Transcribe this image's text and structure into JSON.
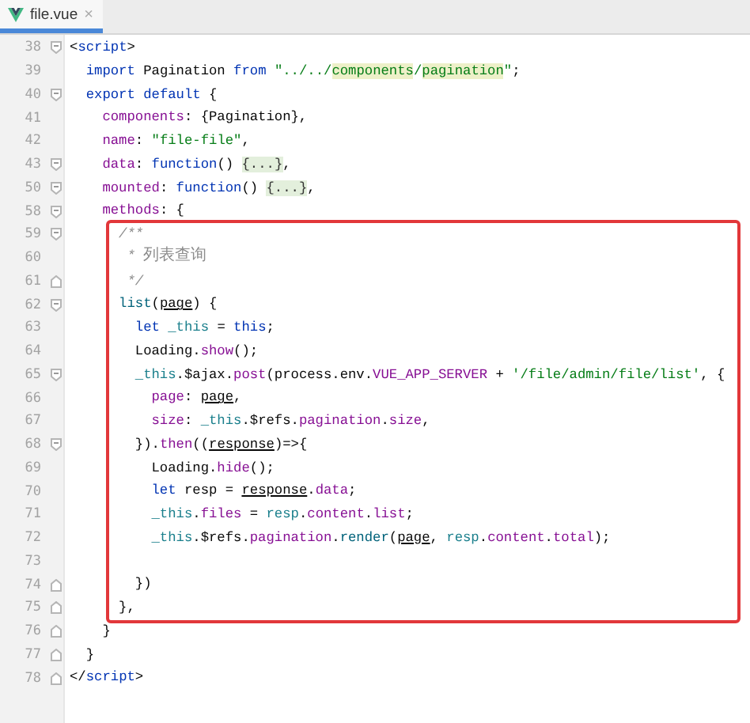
{
  "tab": {
    "label": "file.vue",
    "selected": true,
    "close": "×"
  },
  "editor": {
    "blocks": [
      {
        "highlighted": false,
        "lines": [
          {
            "number": "38",
            "fold_start": true,
            "fold_end": false,
            "tokens": [
              {
                "text": "<",
                "kind": "plain"
              },
              {
                "text": "script",
                "kind": "tag"
              },
              {
                "text": ">",
                "kind": "plain"
              }
            ]
          },
          {
            "number": "39",
            "fold_start": false,
            "fold_end": false,
            "tokens": [
              {
                "text": "  import",
                "kind": "keyword"
              },
              {
                "text": " Pagination ",
                "kind": "plain"
              },
              {
                "text": "from",
                "kind": "keyword"
              },
              {
                "text": " \"../../",
                "kind": "string"
              },
              {
                "text": "components",
                "kind": "string-hl"
              },
              {
                "text": "/",
                "kind": "string"
              },
              {
                "text": "pagination",
                "kind": "string-hl"
              },
              {
                "text": "\"",
                "kind": "string"
              },
              {
                "text": ";",
                "kind": "plain"
              }
            ]
          },
          {
            "number": "40",
            "fold_start": true,
            "fold_end": false,
            "tokens": [
              {
                "text": "  export",
                "kind": "keyword"
              },
              {
                "text": " default",
                "kind": "keyword"
              },
              {
                "text": " {",
                "kind": "plain"
              }
            ]
          },
          {
            "number": "41",
            "fold_start": false,
            "fold_end": false,
            "tokens": [
              {
                "text": "    components",
                "kind": "prop"
              },
              {
                "text": ": {Pagination},",
                "kind": "plain"
              }
            ]
          },
          {
            "number": "42",
            "fold_start": false,
            "fold_end": false,
            "tokens": [
              {
                "text": "    name",
                "kind": "prop"
              },
              {
                "text": ": ",
                "kind": "plain"
              },
              {
                "text": "\"file-file\"",
                "kind": "string"
              },
              {
                "text": ",",
                "kind": "plain"
              }
            ]
          },
          {
            "number": "43",
            "fold_start": true,
            "fold_end": false,
            "tokens": [
              {
                "text": "    data",
                "kind": "prop"
              },
              {
                "text": ": ",
                "kind": "plain"
              },
              {
                "text": "function",
                "kind": "keyword"
              },
              {
                "text": "() ",
                "kind": "plain"
              },
              {
                "text": "{...}",
                "kind": "folded"
              },
              {
                "text": ",",
                "kind": "plain"
              }
            ]
          },
          {
            "number": "50",
            "fold_start": true,
            "fold_end": false,
            "tokens": [
              {
                "text": "    mounted",
                "kind": "prop"
              },
              {
                "text": ": ",
                "kind": "plain"
              },
              {
                "text": "function",
                "kind": "keyword"
              },
              {
                "text": "() ",
                "kind": "plain"
              },
              {
                "text": "{...}",
                "kind": "folded"
              },
              {
                "text": ",",
                "kind": "plain"
              }
            ]
          },
          {
            "number": "58",
            "fold_start": true,
            "fold_end": false,
            "tokens": [
              {
                "text": "    methods",
                "kind": "prop"
              },
              {
                "text": ": {",
                "kind": "plain"
              }
            ]
          }
        ]
      },
      {
        "highlighted": true,
        "lines": [
          {
            "number": "59",
            "fold_start": true,
            "fold_end": false,
            "tokens": [
              {
                "text": "      /**",
                "kind": "comment"
              }
            ]
          },
          {
            "number": "60",
            "fold_start": false,
            "fold_end": false,
            "tokens": [
              {
                "text": "       * ",
                "kind": "comment"
              },
              {
                "text": "列表查询",
                "kind": "comment-cjk"
              }
            ]
          },
          {
            "number": "61",
            "fold_start": false,
            "fold_end": true,
            "tokens": [
              {
                "text": "       */",
                "kind": "comment"
              }
            ]
          },
          {
            "number": "62",
            "fold_start": true,
            "fold_end": false,
            "tokens": [
              {
                "text": "      list",
                "kind": "method"
              },
              {
                "text": "(",
                "kind": "plain"
              },
              {
                "text": "page",
                "kind": "param"
              },
              {
                "text": ") {",
                "kind": "plain"
              }
            ]
          },
          {
            "number": "63",
            "fold_start": false,
            "fold_end": false,
            "tokens": [
              {
                "text": "        let ",
                "kind": "keyword"
              },
              {
                "text": "_this",
                "kind": "local"
              },
              {
                "text": " = ",
                "kind": "plain"
              },
              {
                "text": "this",
                "kind": "keyword"
              },
              {
                "text": ";",
                "kind": "plain"
              }
            ]
          },
          {
            "number": "64",
            "fold_start": false,
            "fold_end": false,
            "tokens": [
              {
                "text": "        Loading.",
                "kind": "plain"
              },
              {
                "text": "show",
                "kind": "prop"
              },
              {
                "text": "();",
                "kind": "plain"
              }
            ]
          },
          {
            "number": "65",
            "fold_start": true,
            "fold_end": false,
            "tokens": [
              {
                "text": "        _this",
                "kind": "local"
              },
              {
                "text": ".$ajax.",
                "kind": "plain"
              },
              {
                "text": "post",
                "kind": "prop"
              },
              {
                "text": "(process.env.",
                "kind": "plain"
              },
              {
                "text": "VUE_APP_SERVER",
                "kind": "prop"
              },
              {
                "text": " + ",
                "kind": "plain"
              },
              {
                "text": "'/file/admin/file/list'",
                "kind": "string"
              },
              {
                "text": ", {",
                "kind": "plain"
              }
            ]
          },
          {
            "number": "66",
            "fold_start": false,
            "fold_end": false,
            "tokens": [
              {
                "text": "          page",
                "kind": "prop"
              },
              {
                "text": ": ",
                "kind": "plain"
              },
              {
                "text": "page",
                "kind": "param"
              },
              {
                "text": ",",
                "kind": "plain"
              }
            ]
          },
          {
            "number": "67",
            "fold_start": false,
            "fold_end": false,
            "tokens": [
              {
                "text": "          size",
                "kind": "prop"
              },
              {
                "text": ": ",
                "kind": "plain"
              },
              {
                "text": "_this",
                "kind": "local"
              },
              {
                "text": ".$refs.",
                "kind": "plain"
              },
              {
                "text": "pagination",
                "kind": "prop"
              },
              {
                "text": ".",
                "kind": "plain"
              },
              {
                "text": "size",
                "kind": "prop"
              },
              {
                "text": ",",
                "kind": "plain"
              }
            ]
          },
          {
            "number": "68",
            "fold_start": true,
            "fold_end": false,
            "tokens": [
              {
                "text": "        }).",
                "kind": "plain"
              },
              {
                "text": "then",
                "kind": "prop"
              },
              {
                "text": "((",
                "kind": "plain"
              },
              {
                "text": "response",
                "kind": "param"
              },
              {
                "text": ")=>{",
                "kind": "plain"
              }
            ]
          },
          {
            "number": "69",
            "fold_start": false,
            "fold_end": false,
            "tokens": [
              {
                "text": "          Loading.",
                "kind": "plain"
              },
              {
                "text": "hide",
                "kind": "prop"
              },
              {
                "text": "();",
                "kind": "plain"
              }
            ]
          },
          {
            "number": "70",
            "fold_start": false,
            "fold_end": false,
            "tokens": [
              {
                "text": "          let",
                "kind": "keyword"
              },
              {
                "text": " resp = ",
                "kind": "plain"
              },
              {
                "text": "response",
                "kind": "param"
              },
              {
                "text": ".",
                "kind": "plain"
              },
              {
                "text": "data",
                "kind": "prop"
              },
              {
                "text": ";",
                "kind": "plain"
              }
            ]
          },
          {
            "number": "71",
            "fold_start": false,
            "fold_end": false,
            "tokens": [
              {
                "text": "          _this",
                "kind": "local"
              },
              {
                "text": ".",
                "kind": "plain"
              },
              {
                "text": "files",
                "kind": "prop"
              },
              {
                "text": " = ",
                "kind": "plain"
              },
              {
                "text": "resp",
                "kind": "local"
              },
              {
                "text": ".",
                "kind": "plain"
              },
              {
                "text": "content",
                "kind": "prop"
              },
              {
                "text": ".",
                "kind": "plain"
              },
              {
                "text": "list",
                "kind": "prop"
              },
              {
                "text": ";",
                "kind": "plain"
              }
            ]
          },
          {
            "number": "72",
            "fold_start": false,
            "fold_end": false,
            "tokens": [
              {
                "text": "          _this",
                "kind": "local"
              },
              {
                "text": ".$refs.",
                "kind": "plain"
              },
              {
                "text": "pagination",
                "kind": "prop"
              },
              {
                "text": ".",
                "kind": "plain"
              },
              {
                "text": "render",
                "kind": "method"
              },
              {
                "text": "(",
                "kind": "plain"
              },
              {
                "text": "page",
                "kind": "param"
              },
              {
                "text": ", ",
                "kind": "plain"
              },
              {
                "text": "resp",
                "kind": "local"
              },
              {
                "text": ".",
                "kind": "plain"
              },
              {
                "text": "content",
                "kind": "prop"
              },
              {
                "text": ".",
                "kind": "plain"
              },
              {
                "text": "total",
                "kind": "prop"
              },
              {
                "text": ");",
                "kind": "plain"
              }
            ]
          },
          {
            "number": "73",
            "fold_start": false,
            "fold_end": false
          },
          {
            "number": "74",
            "fold_start": false,
            "fold_end": true,
            "tokens": [
              {
                "text": "        })",
                "kind": "plain"
              }
            ]
          },
          {
            "number": "75",
            "fold_start": false,
            "fold_end": true,
            "tokens": [
              {
                "text": "      },",
                "kind": "plain"
              }
            ]
          }
        ]
      },
      {
        "highlighted": false,
        "lines": [
          {
            "number": "76",
            "fold_start": false,
            "fold_end": true,
            "tokens": [
              {
                "text": "    }",
                "kind": "plain"
              }
            ]
          },
          {
            "number": "77",
            "fold_start": false,
            "fold_end": true,
            "tokens": [
              {
                "text": "  }",
                "kind": "plain"
              }
            ]
          },
          {
            "number": "78",
            "fold_start": false,
            "fold_end": true,
            "tokens": [
              {
                "text": "</",
                "kind": "plain"
              },
              {
                "text": "script",
                "kind": "tag"
              },
              {
                "text": ">",
                "kind": "plain"
              }
            ]
          }
        ]
      }
    ]
  }
}
